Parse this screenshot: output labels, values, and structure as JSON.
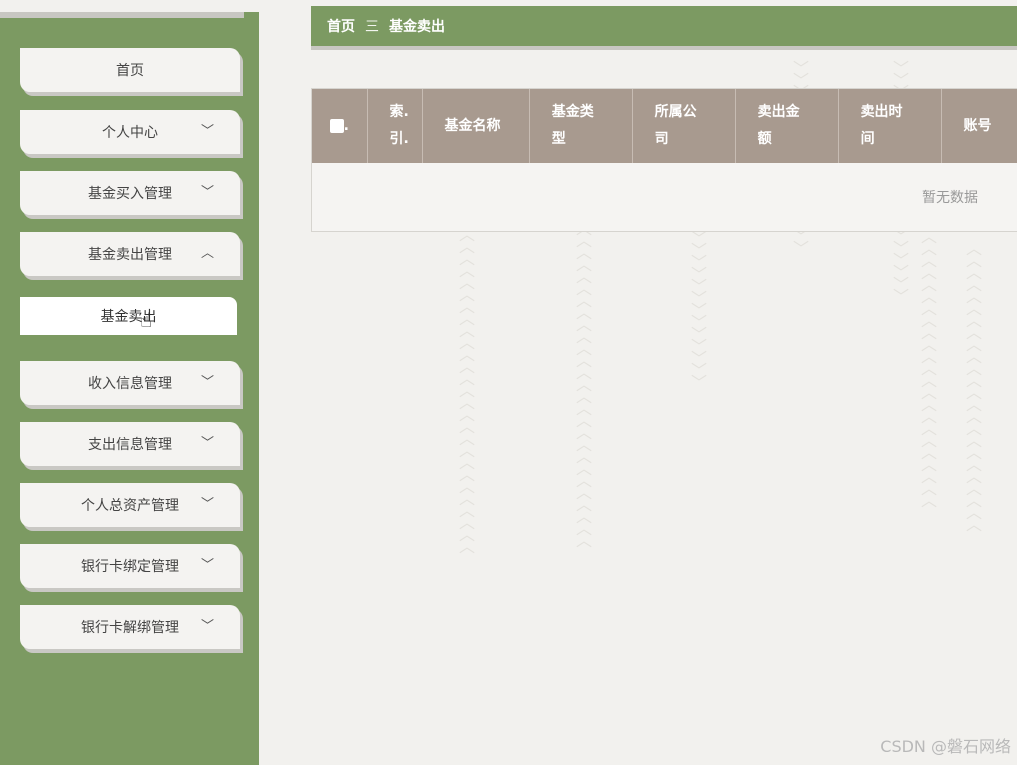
{
  "sidebar": {
    "items": [
      {
        "label": "首页",
        "has_chevron": false
      },
      {
        "label": "个人中心",
        "has_chevron": true,
        "chevron": "down"
      },
      {
        "label": "基金买入管理",
        "has_chevron": true,
        "chevron": "down"
      },
      {
        "label": "基金卖出管理",
        "has_chevron": true,
        "chevron": "up",
        "expanded": true
      },
      {
        "label": "收入信息管理",
        "has_chevron": true,
        "chevron": "down"
      },
      {
        "label": "支出信息管理",
        "has_chevron": true,
        "chevron": "down"
      },
      {
        "label": "个人总资产管理",
        "has_chevron": true,
        "chevron": "down"
      },
      {
        "label": "银行卡绑定管理",
        "has_chevron": true,
        "chevron": "down"
      },
      {
        "label": "银行卡解绑管理",
        "has_chevron": true,
        "chevron": "down"
      }
    ],
    "submenu": {
      "label": "基金卖出"
    }
  },
  "breadcrumb": {
    "home": "首页",
    "separator": "三",
    "current": "基金卖出"
  },
  "table": {
    "columns": [
      {
        "key": "checkbox",
        "label": ""
      },
      {
        "key": "index",
        "label": "索.引."
      },
      {
        "key": "name",
        "label": "基金名称"
      },
      {
        "key": "type",
        "label": "基金类型"
      },
      {
        "key": "company",
        "label": "所属公司"
      },
      {
        "key": "amount",
        "label": "卖出金额"
      },
      {
        "key": "time",
        "label": "卖出时间"
      },
      {
        "key": "account",
        "label": "账号"
      }
    ],
    "rows": [],
    "empty_text": "暂无数据"
  },
  "watermark": "CSDN @磐石网络",
  "colors": {
    "sidebar_bg": "#7c9a62",
    "header_bg": "#7c9a62",
    "table_header_bg": "#a89a8f",
    "page_bg": "#f2f1ee"
  }
}
